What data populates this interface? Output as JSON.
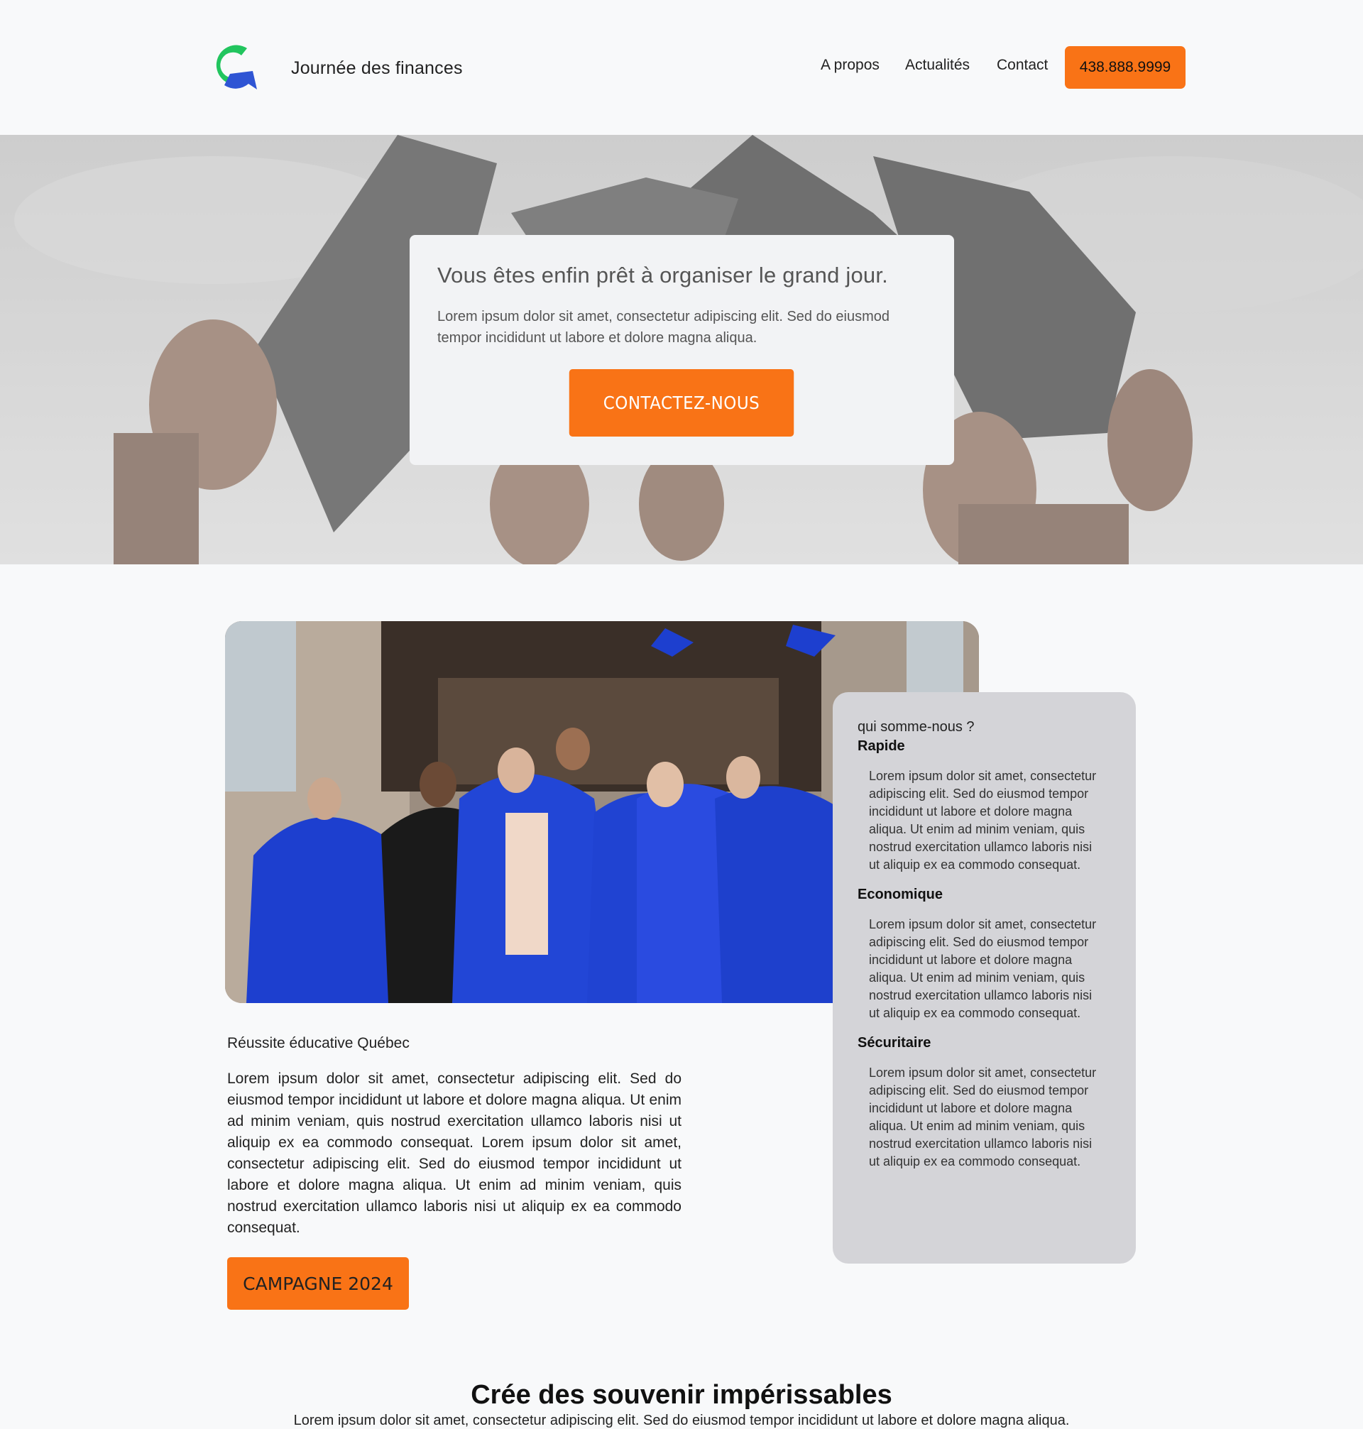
{
  "header": {
    "brand": "Journée des finances",
    "nav": [
      "A propos",
      "Actualités",
      "Contact"
    ],
    "phone": "438.888.9999"
  },
  "hero": {
    "title": "Vous êtes enfin prêt à organiser le grand jour.",
    "text": "Lorem ipsum dolor sit amet, consectetur adipiscing elit. Sed do eiusmod tempor incididunt ut labore et dolore magna aliqua.",
    "cta": "CONTACTEZ-NOUS"
  },
  "about": {
    "intro": "qui somme-nous ?",
    "features": [
      {
        "title": "Rapide",
        "text": "Lorem ipsum dolor sit amet, consectetur adipiscing elit. Sed do eiusmod tempor incididunt ut labore et dolore magna aliqua. Ut enim ad minim veniam, quis nostrud exercitation ullamco laboris nisi ut aliquip ex ea commodo consequat."
      },
      {
        "title": "Economique",
        "text": "Lorem ipsum dolor sit amet, consectetur adipiscing elit. Sed do eiusmod tempor incididunt ut labore et dolore magna aliqua. Ut enim ad minim veniam, quis nostrud exercitation ullamco laboris nisi ut aliquip ex ea commodo consequat."
      },
      {
        "title": "Sécuritaire",
        "text": "Lorem ipsum dolor sit amet, consectetur adipiscing elit. Sed do eiusmod tempor incididunt ut labore et dolore magna aliqua. Ut enim ad minim veniam, quis nostrud exercitation ullamco laboris nisi ut aliquip ex ea commodo consequat."
      }
    ],
    "section_title": "Réussite éducative Québec",
    "section_text": "Lorem ipsum dolor sit amet, consectetur adipiscing elit. Sed do eiusmod tempor incididunt ut labore et dolore magna aliqua. Ut enim ad minim veniam, quis nostrud exercitation ullamco laboris nisi ut aliquip ex ea commodo consequat. Lorem ipsum dolor sit amet, consectetur adipiscing elit. Sed do eiusmod tempor incididunt ut labore et dolore magna aliqua. Ut enim ad minim veniam, quis nostrud exercitation ullamco laboris nisi ut aliquip ex ea commodo consequat.",
    "campaign_button": "CAMPAGNE 2024"
  },
  "bottom": {
    "title": "Crée des souvenir impérissables",
    "text": "Lorem ipsum dolor sit amet, consectetur adipiscing elit. Sed do eiusmod tempor incididunt ut labore et dolore magna aliqua."
  },
  "colors": {
    "accent": "#f97316",
    "card_gray": "#d4d4d8",
    "logo_green": "#22c55e",
    "logo_blue": "#2f55d4"
  }
}
